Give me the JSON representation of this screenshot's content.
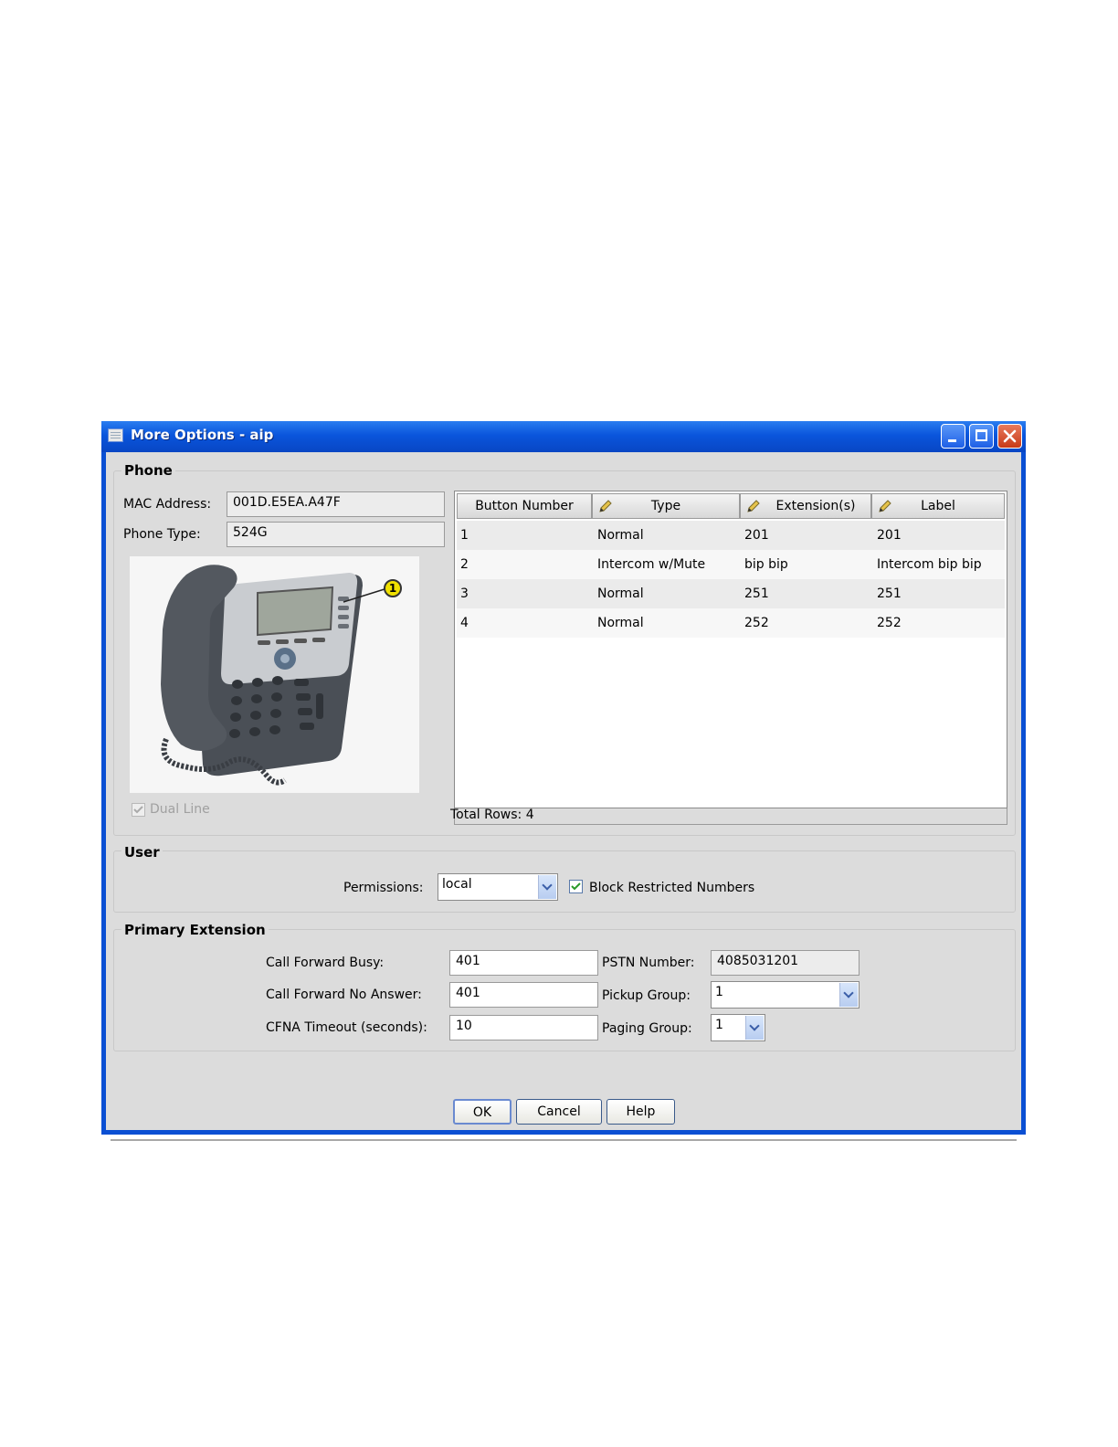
{
  "window": {
    "title": "More Options - aip"
  },
  "phone": {
    "section_title": "Phone",
    "mac_label": "MAC Address:",
    "mac_value": "001D.E5EA.A47F",
    "type_label": "Phone Type:",
    "type_value": "524G",
    "callout_number": "1",
    "dual_line_label": "Dual Line",
    "dual_line_checked": true
  },
  "buttons_table": {
    "headers": [
      "Button Number",
      "Type",
      "Extension(s)",
      "Label"
    ],
    "rows": [
      {
        "number": "1",
        "type": "Normal",
        "extension": "201",
        "label": "201"
      },
      {
        "number": "2",
        "type": "Intercom w/Mute",
        "extension": "bip bip",
        "label": "Intercom bip bip"
      },
      {
        "number": "3",
        "type": "Normal",
        "extension": "251",
        "label": "251"
      },
      {
        "number": "4",
        "type": "Normal",
        "extension": "252",
        "label": "252"
      }
    ],
    "total_rows_text": "Total Rows: 4"
  },
  "user": {
    "section_title": "User",
    "permissions_label": "Permissions:",
    "permissions_value": "local",
    "block_label": "Block Restricted Numbers",
    "block_checked": true
  },
  "primary_extension": {
    "section_title": "Primary Extension",
    "cfb_label": "Call Forward Busy:",
    "cfb_value": "401",
    "cfna_label": "Call Forward No Answer:",
    "cfna_value": "401",
    "timeout_label": "CFNA Timeout (seconds):",
    "timeout_value": "10",
    "pstn_label": "PSTN Number:",
    "pstn_value": "4085031201",
    "pickup_label": "Pickup Group:",
    "pickup_value": "1",
    "paging_label": "Paging Group:",
    "paging_value": "1"
  },
  "actions": {
    "ok": "OK",
    "cancel": "Cancel",
    "help": "Help"
  },
  "icons": [
    "window-icon",
    "minimize-icon",
    "maximize-icon",
    "close-icon",
    "pencil-icon",
    "dropdown-arrow-icon",
    "checkbox-icon"
  ],
  "colors": {
    "title_bar": "#0a55dc",
    "client_bg": "#dcdcdc",
    "close_button": "#c83a18",
    "callout": "#f0e000"
  }
}
